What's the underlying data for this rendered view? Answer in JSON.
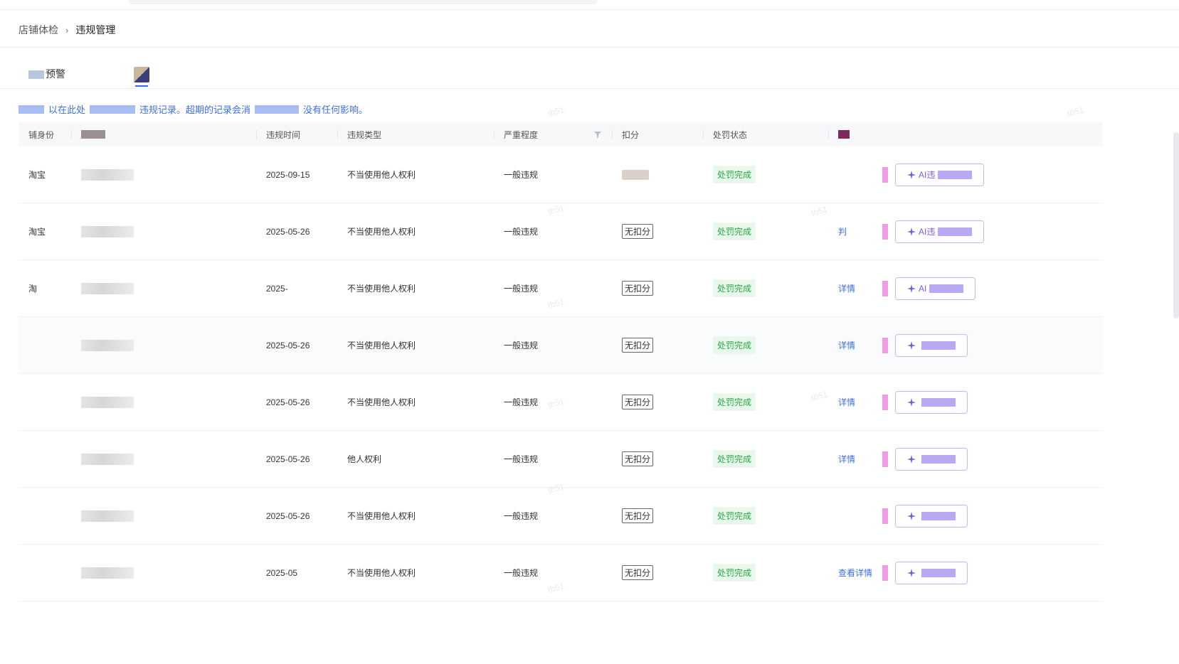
{
  "breadcrumb": {
    "parent": "店铺体检",
    "separator": "›",
    "current": "违规管理"
  },
  "tabs": [
    {
      "label": "预警",
      "active": true
    }
  ],
  "notice": {
    "part1": "以在此处",
    "part2": "违规记录。超期的记录会消",
    "part3": "没有任何影响。"
  },
  "table": {
    "headers": {
      "identity": "铺身份",
      "time": "违规时间",
      "type": "违规类型",
      "severity": "严重程度",
      "deduct": "扣分",
      "status": "处罚状态"
    },
    "rows": [
      {
        "platform": "淘宝",
        "date": "2025-09-15",
        "type": "不当使用他人权利",
        "severity": "一般违规",
        "deduct": "",
        "status": "处罚完成",
        "detail": "",
        "ai": "AI违"
      },
      {
        "platform": "淘宝",
        "date": "2025-05-26",
        "type": "不当使用他人权利",
        "severity": "一般违规",
        "deduct": "无扣分",
        "status": "处罚完成",
        "detail": "判",
        "ai": "AI违"
      },
      {
        "platform": "淘",
        "date": "2025-",
        "type": "不当使用他人权利",
        "severity": "一般违规",
        "deduct": "无扣分",
        "status": "处罚完成",
        "detail": "详情",
        "ai": "AI"
      },
      {
        "platform": "",
        "date": "2025-05-26",
        "type": "不当使用他人权利",
        "severity": "一般违规",
        "deduct": "无扣分",
        "status": "处罚完成",
        "detail": "详情",
        "ai": ""
      },
      {
        "platform": "",
        "date": "2025-05-26",
        "type": "不当使用他人权利",
        "severity": "一般违规",
        "deduct": "无扣分",
        "status": "处罚完成",
        "detail": "详情",
        "ai": ""
      },
      {
        "platform": "",
        "date": "2025-05-26",
        "type": "他人权利",
        "severity": "一般违规",
        "deduct": "无扣分",
        "status": "处罚完成",
        "detail": "详情",
        "ai": ""
      },
      {
        "platform": "",
        "date": "2025-05-26",
        "type": "不当使用他人权利",
        "severity": "一般违规",
        "deduct": "无扣分",
        "status": "处罚完成",
        "detail": "",
        "ai": ""
      },
      {
        "platform": "",
        "date": "2025-05",
        "type": "不当使用他人权利",
        "severity": "一般违规",
        "deduct": "无扣分",
        "status": "处罚完成",
        "detail": "查看详情",
        "ai": ""
      }
    ]
  },
  "watermark": "tb51",
  "colors": {
    "accent": "#3b6fe0",
    "success": "#2aa84a",
    "ai": "#7a5ce0",
    "tab_indicator": "#2f6bff"
  },
  "icons": {
    "filter": "funnel-icon",
    "ai": "sparkle-icon",
    "breadcrumb_separator": "chevron-right-icon"
  }
}
